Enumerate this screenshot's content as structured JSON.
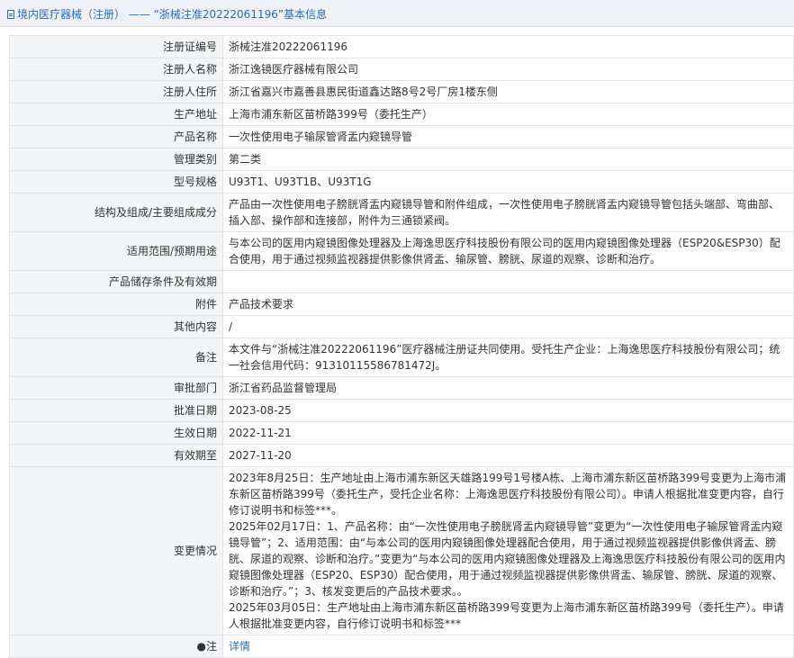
{
  "header": {
    "prefix": "境内医疗器械（注册）",
    "separator": " —— ",
    "title": "“浙械注准20222061196”基本信息"
  },
  "rows": [
    {
      "label": "注册证编号",
      "value": "浙械注准20222061196"
    },
    {
      "label": "注册人名称",
      "value": "浙江逸镜医疗器械有限公司"
    },
    {
      "label": "注册人住所",
      "value": "浙江省嘉兴市嘉善县惠民街道鑫达路8号2号厂房1楼东侧"
    },
    {
      "label": "生产地址",
      "value": "上海市浦东新区苗桥路399号（委托生产）"
    },
    {
      "label": "产品名称",
      "value": "一次性使用电子输尿管肾盂内窥镜导管"
    },
    {
      "label": "管理类别",
      "value": "第二类"
    },
    {
      "label": "型号规格",
      "value": "U93T1、U93T1B、U93T1G"
    },
    {
      "label": "结构及组成/主要组成成分",
      "value": "产品由一次性使用电子膀胱肾盂内窥镜导管和附件组成，一次性使用电子膀胱肾盂内窥镜导管包括头端部、弯曲部、插入部、操作部和连接部，附件为三通锁紧阀。"
    },
    {
      "label": "适用范围/预期用途",
      "value": "与本公司的医用内窥镜图像处理器及上海逸思医疗科技股份有限公司的医用内窥镜图像处理器（ESP20&ESP30）配合使用，用于通过视频监视器提供影像供肾盂、输尿管、膀胱、尿道的观察、诊断和治疗。"
    },
    {
      "label": "产品储存条件及有效期",
      "value": ""
    },
    {
      "label": "附件",
      "value": "产品技术要求"
    },
    {
      "label": "其他内容",
      "value": "/"
    },
    {
      "label": "备注",
      "value": "本文件与“浙械注准20222061196”医疗器械注册证共同使用。受托生产企业：上海逸思医疗科技股份有限公司；统一社会信用代码：91310115586781472J。"
    },
    {
      "label": "审批部门",
      "value": "浙江省药品监督管理局"
    },
    {
      "label": "批准日期",
      "value": "2023-08-25"
    },
    {
      "label": "生效日期",
      "value": "2022-11-21"
    },
    {
      "label": "有效期至",
      "value": "2027-11-20"
    }
  ],
  "changes": {
    "label": "变更情况",
    "entries": [
      "2023年8月25日：生产地址由上海市浦东新区天雄路199号1号楼A栋、上海市浦东新区苗桥路399号变更为上海市浦东新区苗桥路399号（委托生产，受托企业名称：上海逸思医疗科技股份有限公司）。申请人根据批准变更内容，自行修订说明书和标签***。",
      "2025年02月17日：1、产品名称：由“一次性使用电子膀胱肾盂内窥镜导管”变更为“一次性使用电子输尿管肾盂内窥镜导管”；2、适用范围：由“与本公司的医用内窥镜图像处理器配合使用，用于通过视频监视器提供影像供肾盂、膀胱、尿道的观察、诊断和治疗。”变更为“与本公司的医用内窥镜图像处理器及上海逸思医疗科技股份有限公司的医用内窥镜图像处理器（ESP20、ESP30）配合使用，用于通过视频监视器提供影像供肾盂、输尿管、膀胱、尿道的观察、诊断和治疗。”；3、核发变更后的产品技术要求。。",
      "2025年03月05日：生产地址由上海市浦东新区苗桥路399号变更为上海市浦东新区苗桥路399号（委托生产）。申请人根据批准变更内容，自行修订说明书和标签***"
    ]
  },
  "footer_row": {
    "label": "●注",
    "value": "详情"
  }
}
